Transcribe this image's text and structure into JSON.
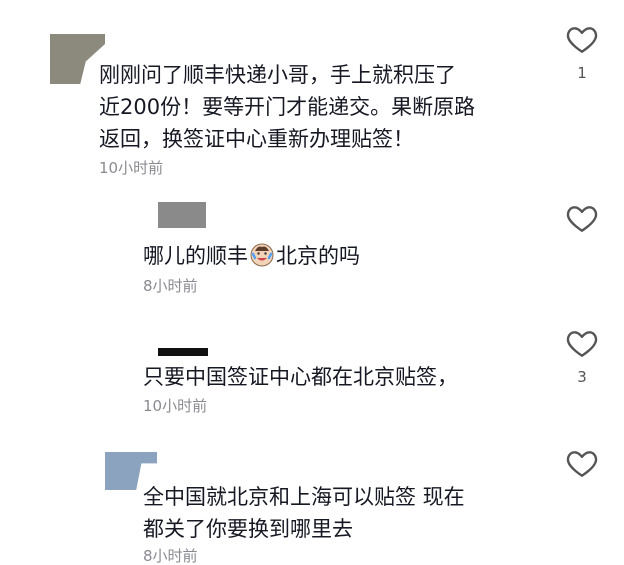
{
  "comments": [
    {
      "lines": [
        "刚刚问了顺丰快递小哥，手上就积压了",
        "近200份！要等开门才能递交。果断原路",
        "返回，换签证中心重新办理贴签！"
      ],
      "time": "10小时前",
      "likes": "1",
      "avatar_color": "#8c8a7c"
    },
    {
      "text_before": "哪儿的顺丰",
      "emoji": "crying-laughing-face-icon",
      "text_after": "北京的吗",
      "time": "8小时前",
      "likes": ""
    },
    {
      "lines": [
        "只要中国签证中心都在北京贴签，"
      ],
      "time": "10小时前",
      "likes": "3"
    },
    {
      "lines": [
        "全中国就北京和上海可以贴签 现在",
        "都关了你要换到哪里去"
      ],
      "time": "8小时前",
      "likes": "",
      "avatar_color": "#8ba3bf"
    }
  ]
}
